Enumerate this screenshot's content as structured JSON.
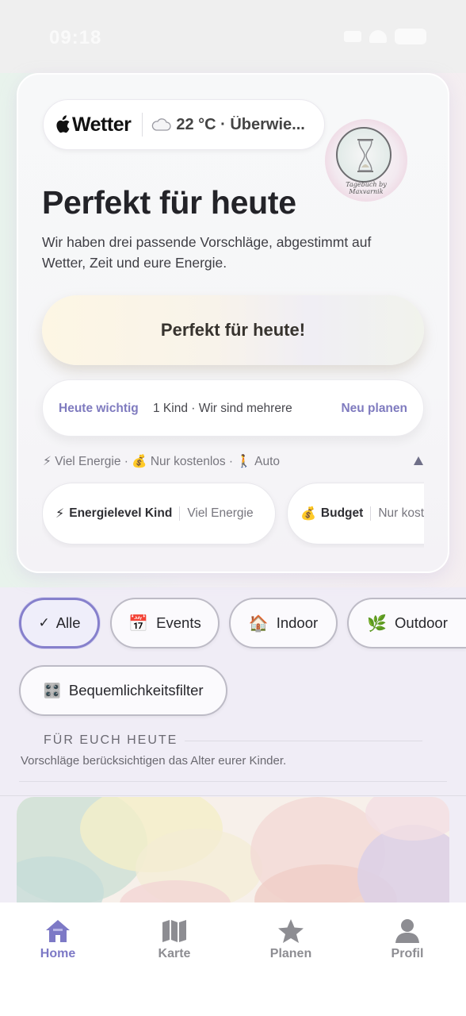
{
  "status_bar": {
    "time": "09:18"
  },
  "weather": {
    "brand": "Wetter",
    "info": "22 °C · Überwie..."
  },
  "logo": {
    "text": "Tagebuch by Maxvarnik"
  },
  "hero": {
    "title": "Perfekt für heute",
    "subtitle": "Wir haben drei passende Vorschläge, abgestimmt auf Wetter, Zeit und eure Energie.",
    "cta_label": "Perfekt für heute!"
  },
  "plan": {
    "label": "Heute wichtig",
    "info": "1 Kind · Wir sind mehrere",
    "link": "Neu planen"
  },
  "energy_summary": "⚡ Viel Energie · 💰 Nur kostenlos · 🚶 Auto",
  "filter_cards": [
    {
      "icon": "⚡",
      "name": "Energielevel Kind",
      "value": "Viel Energie"
    },
    {
      "icon": "💰",
      "name": "Budget",
      "value": "Nur kostenlos"
    }
  ],
  "chips": {
    "all": {
      "icon": "✓",
      "label": "Alle"
    },
    "events": {
      "icon": "📅",
      "label": "Events"
    },
    "indoor": {
      "icon": "🏠",
      "label": "Indoor"
    },
    "outdoor": {
      "icon": "🌿",
      "label": "Outdoor"
    },
    "comfort": {
      "icon": "🎛️",
      "label": "Bequemlichkeitsfilter"
    }
  },
  "section": {
    "title": "FÜR EUCH HEUTE",
    "note": "Vorschläge berücksichtigen das Alter eurer Kinder."
  },
  "tabs": [
    {
      "label": "Home",
      "icon": "home-icon",
      "active": true
    },
    {
      "label": "Karte",
      "icon": "map-icon",
      "active": false
    },
    {
      "label": "Planen",
      "icon": "star-icon",
      "active": false
    },
    {
      "label": "Profil",
      "icon": "person-icon",
      "active": false
    }
  ],
  "colors": {
    "accent": "#7d79c6",
    "accent_text": "#7f7bbf",
    "inactive_tab": "#8d8d92",
    "chip_border": "#bdbbc6"
  }
}
